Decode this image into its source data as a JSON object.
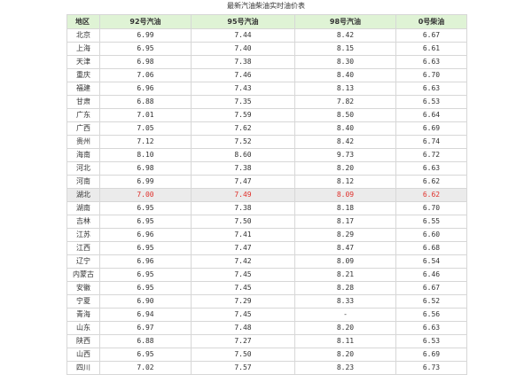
{
  "page": {
    "title": "最新汽油柴油实时油价表"
  },
  "colors": {
    "header_bg": "#dff3d5",
    "highlight_bg": "#ebebeb",
    "highlight_text": "#e0312c",
    "border": "#d7d7d7"
  },
  "table": {
    "headers": [
      "地区",
      "92号汽油",
      "95号汽油",
      "98号汽油",
      "0号柴油"
    ],
    "highlight_row_index": 12,
    "rows": [
      [
        "北京",
        "6.99",
        "7.44",
        "8.42",
        "6.67"
      ],
      [
        "上海",
        "6.95",
        "7.40",
        "8.15",
        "6.61"
      ],
      [
        "天津",
        "6.98",
        "7.38",
        "8.30",
        "6.63"
      ],
      [
        "重庆",
        "7.06",
        "7.46",
        "8.40",
        "6.70"
      ],
      [
        "福建",
        "6.96",
        "7.43",
        "8.13",
        "6.63"
      ],
      [
        "甘肃",
        "6.88",
        "7.35",
        "7.82",
        "6.53"
      ],
      [
        "广东",
        "7.01",
        "7.59",
        "8.50",
        "6.64"
      ],
      [
        "广西",
        "7.05",
        "7.62",
        "8.40",
        "6.69"
      ],
      [
        "贵州",
        "7.12",
        "7.52",
        "8.42",
        "6.74"
      ],
      [
        "海南",
        "8.10",
        "8.60",
        "9.73",
        "6.72"
      ],
      [
        "河北",
        "6.98",
        "7.38",
        "8.20",
        "6.63"
      ],
      [
        "河南",
        "6.99",
        "7.47",
        "8.12",
        "6.62"
      ],
      [
        "湖北",
        "7.00",
        "7.49",
        "8.09",
        "6.62"
      ],
      [
        "湖南",
        "6.95",
        "7.38",
        "8.18",
        "6.70"
      ],
      [
        "吉林",
        "6.95",
        "7.50",
        "8.17",
        "6.55"
      ],
      [
        "江苏",
        "6.96",
        "7.41",
        "8.29",
        "6.60"
      ],
      [
        "江西",
        "6.95",
        "7.47",
        "8.47",
        "6.68"
      ],
      [
        "辽宁",
        "6.96",
        "7.42",
        "8.09",
        "6.54"
      ],
      [
        "内蒙古",
        "6.95",
        "7.45",
        "8.21",
        "6.46"
      ],
      [
        "安徽",
        "6.95",
        "7.45",
        "8.28",
        "6.67"
      ],
      [
        "宁夏",
        "6.90",
        "7.29",
        "8.33",
        "6.52"
      ],
      [
        "青海",
        "6.94",
        "7.45",
        "-",
        "6.56"
      ],
      [
        "山东",
        "6.97",
        "7.48",
        "8.20",
        "6.63"
      ],
      [
        "陕西",
        "6.88",
        "7.27",
        "8.11",
        "6.53"
      ],
      [
        "山西",
        "6.95",
        "7.50",
        "8.20",
        "6.69"
      ],
      [
        "四川",
        "7.02",
        "7.57",
        "8.23",
        "6.73"
      ]
    ]
  }
}
